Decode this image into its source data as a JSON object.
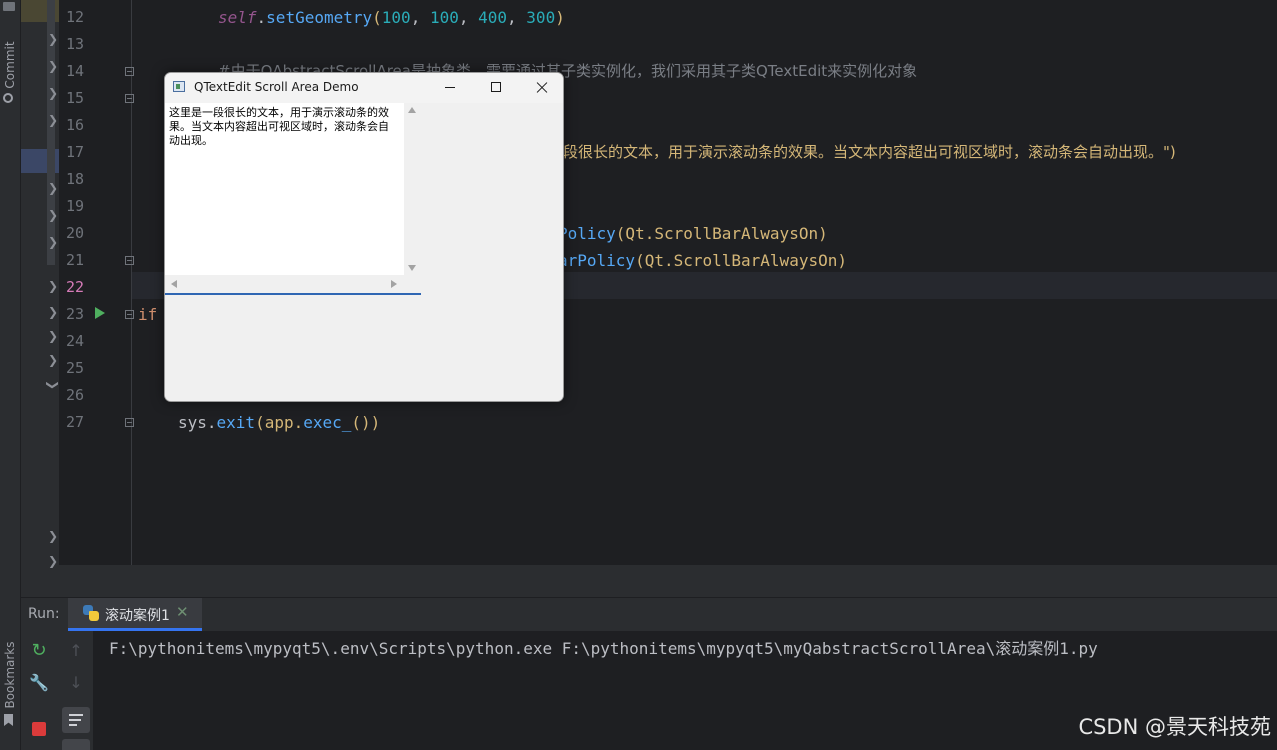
{
  "tool_strip": {
    "commit_label": "Commit",
    "bookmarks_label": "Bookmarks"
  },
  "editor": {
    "line_numbers": [
      "12",
      "13",
      "14",
      "15",
      "16",
      "17",
      "18",
      "19",
      "20",
      "21",
      "22",
      "23",
      "24",
      "25",
      "26",
      "27"
    ],
    "current_line": "22",
    "code_visible_fragments": {
      "line_12_self": "self",
      "line_12_dot": ".",
      "line_12_call": "setGeometry",
      "line_12_open": "(",
      "line_12_a": "100",
      "line_12_b": "100",
      "line_12_c": "400",
      "line_12_d": "300",
      "line_12_close": ")",
      "line_12_sep": ", ",
      "line_14_comment": "#由于QAbstractScrollArea是抽象类，需要通过其子类实例化，我们采用其子类QTextEdit来实例化对象",
      "line_17_string": "段很长的文本，用于演示滚动条的效果。当文本内容超出可视区域时，滚动条会自动出现。\")",
      "line_20_method": "Policy",
      "line_20_args": "(Qt.ScrollBarAlwaysOn)",
      "line_21_method": "arPolicy",
      "line_21_args": "(Qt.ScrollBarAlwaysOn)",
      "line_23_keyword": "if",
      "line_27_obj": "sys.",
      "line_27_call": "exit",
      "line_27_open": "(app.",
      "line_27_inner": "exec_",
      "line_27_close": "())"
    }
  },
  "popup": {
    "title": "QTextEdit Scroll Area Demo",
    "text_content": "这里是一段很长的文本，用于演示滚动条的效果。当文本内容超出可视区域时，滚动条会自动出现。",
    "controls": [
      "minimize-icon",
      "maximize-icon",
      "close-icon"
    ]
  },
  "run_panel": {
    "label": "Run:",
    "tab_label": "滚动案例1",
    "tab_close": "✕",
    "console_line": "F:\\pythonitems\\mypyqt5\\.env\\Scripts\\python.exe F:\\pythonitems\\mypyqt5\\myQabstractScrollArea\\滚动案例1.py"
  },
  "watermark": "CSDN @景天科技苑",
  "colors": {
    "editor_bg": "#1e1f22",
    "panel_bg": "#2b2d30",
    "accent_blue": "#3574f0",
    "run_green": "#4faf5f",
    "stop_red": "#db3b3b"
  }
}
